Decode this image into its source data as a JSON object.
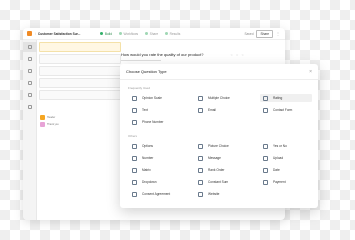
{
  "topbar": {
    "title": "Customer Satisfaction Sur...",
    "steps": [
      {
        "label": "Build"
      },
      {
        "label": "Workflows"
      },
      {
        "label": "Share"
      },
      {
        "label": "Results"
      }
    ],
    "save_label": "Saved",
    "share_label": "Share"
  },
  "editor": {
    "question": "How would you rate the quality of our product?"
  },
  "question_list": {
    "rows": [
      {
        "label": "Header"
      },
      {
        "label": "Thank you"
      }
    ]
  },
  "modal": {
    "title": "Choose Question Type",
    "sections": [
      {
        "title": "Frequently Used",
        "items": [
          {
            "label": "Opinion Scale",
            "icon": "scale-icon"
          },
          {
            "label": "Multiple Choice",
            "icon": "list-icon"
          },
          {
            "label": "Rating",
            "icon": "star-icon"
          },
          {
            "label": "Text",
            "icon": "text-icon"
          },
          {
            "label": "Email",
            "icon": "email-icon"
          },
          {
            "label": "Contact Form",
            "icon": "contact-icon"
          },
          {
            "label": "Phone Number",
            "icon": "phone-icon"
          }
        ]
      },
      {
        "title": "Others",
        "items": [
          {
            "label": "Options",
            "icon": "options-icon"
          },
          {
            "label": "Picture Choice",
            "icon": "picture-icon"
          },
          {
            "label": "Yes or No",
            "icon": "yesno-icon"
          },
          {
            "label": "Number",
            "icon": "number-icon"
          },
          {
            "label": "Message",
            "icon": "message-icon"
          },
          {
            "label": "Upload",
            "icon": "upload-icon"
          },
          {
            "label": "Matrix",
            "icon": "matrix-icon"
          },
          {
            "label": "Rank Order",
            "icon": "rank-icon"
          },
          {
            "label": "Date",
            "icon": "date-icon"
          },
          {
            "label": "Dropdown",
            "icon": "dropdown-icon"
          },
          {
            "label": "Constant Sum",
            "icon": "sum-icon"
          },
          {
            "label": "Payment",
            "icon": "payment-icon"
          },
          {
            "label": "Consent Agreement",
            "icon": "consent-icon"
          },
          {
            "label": "Website",
            "icon": "website-icon"
          }
        ]
      }
    ]
  }
}
